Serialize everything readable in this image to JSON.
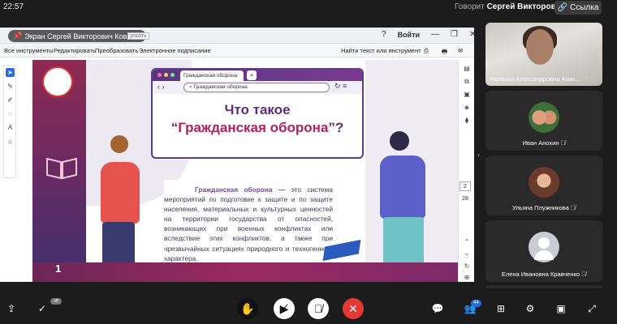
{
  "topbar": {
    "time": "22:57",
    "speaker_prefix": "Говорит",
    "speaker_name": "Сергей Викторович К.",
    "link_label": "Ссылка",
    "link_icon": "link-icon"
  },
  "screen_share": {
    "label": "Экран Сергей Викторович Ковалев",
    "share_btn": "ускать",
    "sign_in": "Войти",
    "menu": [
      "Все инструменты",
      "Редактировать",
      "Преобразовать",
      "Электронное подписание"
    ],
    "search": "Найти текст или инструмент",
    "page_current": "2",
    "page_total": "28"
  },
  "slide": {
    "tab_title": "Гражданская оборона",
    "address": "Гражданская оборона",
    "question_line1": "Что такое",
    "question_line2_open": "“",
    "question_line2_term": "Гражданская оборона",
    "question_line2_close": "”?",
    "definition_term": "Гражданская оборона —",
    "definition_text": " это система мероприятий по подготовке к защите и по защите населения, материальных и культурных ценностей на территории государства от опасностей, возникающих при военных конфликтах или вследствие этих конфликтов, а также при чрезвычайных ситуациях природного и техногенного характера.",
    "slide_number": "1"
  },
  "participants": [
    {
      "name": "Наталья Александровна Акин…",
      "mic": "muted"
    },
    {
      "name": "Иван Анохин",
      "mic": "muted"
    },
    {
      "name": "Ульяна Плужникова",
      "mic": "muted"
    },
    {
      "name": "Елена Ивановна Кравченко",
      "mic": "muted"
    }
  ],
  "bottombar": {
    "participants_count": "44",
    "pill_label": "off"
  }
}
